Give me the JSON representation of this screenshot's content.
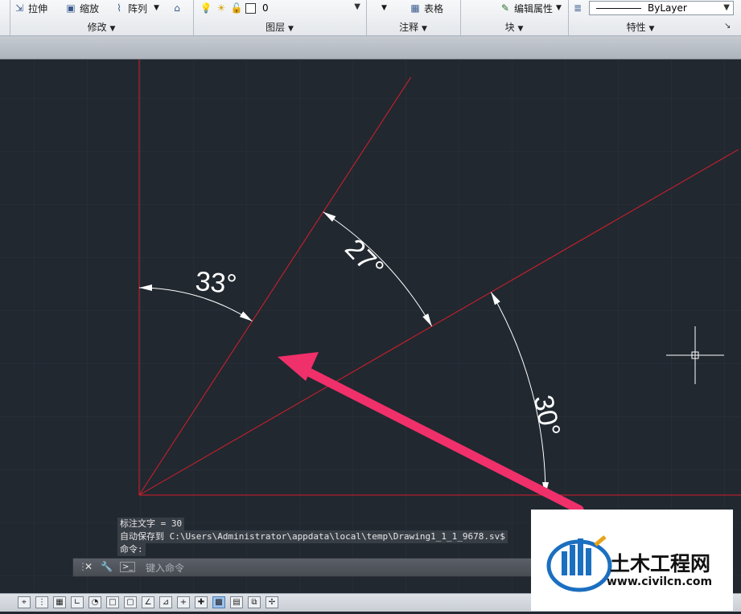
{
  "ribbon": {
    "modify": {
      "stretch": "拉伸",
      "scale": "缩放",
      "array": "阵列",
      "title": "修改"
    },
    "layers": {
      "current_layer": "0",
      "title": "图层"
    },
    "annotation": {
      "table": "表格",
      "title": "注释"
    },
    "block": {
      "edit_attributes": "编辑属性",
      "title": "块"
    },
    "properties": {
      "linetype": "ByLayer",
      "title": "特性"
    }
  },
  "drawing": {
    "dimensions": [
      {
        "label": "33°",
        "angle": 33
      },
      {
        "label": "27°",
        "angle": 27
      },
      {
        "label": "30°",
        "angle": 30
      }
    ],
    "line_color": "#d81e2a",
    "dim_color": "#ffffff",
    "arrow_color": "#f0306a"
  },
  "command": {
    "history": [
      "标注文字 = 30",
      "自动保存到 C:\\Users\\Administrator\\appdata\\local\\temp\\Drawing1_1_1_9678.sv$",
      "命令:"
    ],
    "placeholder": "键入命令"
  },
  "watermark": {
    "name": "土木工程网",
    "url": "www.civilcn.com"
  }
}
